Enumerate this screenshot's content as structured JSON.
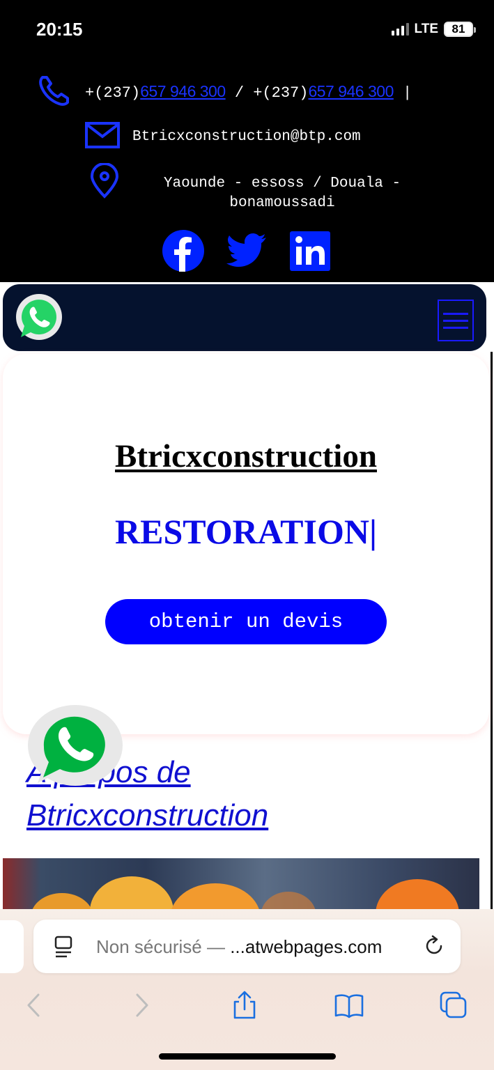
{
  "status_bar": {
    "time": "20:15",
    "network": "LTE",
    "battery": "81"
  },
  "contact": {
    "phone_prefix_1": "+(237)",
    "phone_number_1": "657 946 300",
    "separator": " / ",
    "phone_prefix_2": "+(237)",
    "phone_number_2": "657 946 300",
    "phone_suffix": " |",
    "email": "Btricxconstruction@btp.com",
    "address_line_1": "Yaounde - essoss / Douala -",
    "address_line_2": "bonamoussadi"
  },
  "social": [
    "facebook-icon",
    "twitter-icon",
    "linkedin-icon"
  ],
  "hero": {
    "title": "Btricxconstruction",
    "subtitle": "RESTORATION|",
    "cta_label": "obtenir un devis"
  },
  "about": {
    "heading_line_1": "A propos de",
    "heading_line_2": "Btricxconstruction"
  },
  "browser": {
    "url_prefix": "Non sécurisé — ",
    "url_domain": "...atwebpages.com"
  },
  "colors": {
    "brand_blue": "#0000ff",
    "nav_bg": "#05122e",
    "whatsapp_green": "#25d366"
  }
}
